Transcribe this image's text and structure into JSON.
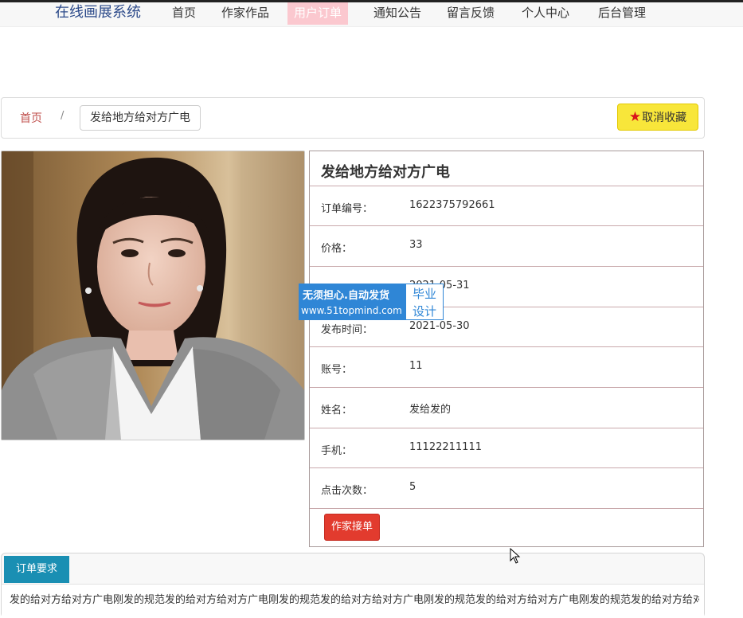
{
  "nav": {
    "brand": "在线画展系统",
    "items": [
      {
        "label": "首页",
        "active": false
      },
      {
        "label": "作家作品",
        "active": false
      },
      {
        "label": "用户订单",
        "active": true
      },
      {
        "label": "通知公告",
        "active": false
      },
      {
        "label": "留言反馈",
        "active": false
      },
      {
        "label": "个人中心",
        "active": false
      },
      {
        "label": "后台管理",
        "active": false
      }
    ]
  },
  "breadcrumb": {
    "home": "首页",
    "separator": "/",
    "current": "发给地方给对方广电"
  },
  "favorite": {
    "label": "取消收藏",
    "icon": "star-icon"
  },
  "detail": {
    "title": "发给地方给对方广电",
    "rows": [
      {
        "label": "订单编号：",
        "value": "1622375792661"
      },
      {
        "label": "价格：",
        "value": "33"
      },
      {
        "label": "",
        "value": "2021-05-31"
      },
      {
        "label": "发布时间：",
        "value": "2021-05-30"
      },
      {
        "label": "账号：",
        "value": "11"
      },
      {
        "label": "姓名：",
        "value": "发给发的"
      },
      {
        "label": "手机：",
        "value": "11122211111"
      },
      {
        "label": "点击次数：",
        "value": "5"
      }
    ],
    "accept_label": "作家接单"
  },
  "watermark": {
    "line1": "无须担心.自动发货",
    "line2": "www.51topmind.com",
    "badge_top": "毕业",
    "badge_bottom": "设计"
  },
  "requirements": {
    "tab_label": "订单要求",
    "text": "发的给对方给对方广电刚发的规范发的给对方给对方广电刚发的规范发的给对方给对方广电刚发的规范发的给对方给对方广电刚发的规范发的给对方给对方"
  },
  "colors": {
    "accent_red": "#e23b2e",
    "tab_blue": "#1a8fb3",
    "favorite_yellow": "#f8e63a",
    "brand_blue": "#2c4a8a",
    "watermark_blue": "#2f86d6"
  }
}
